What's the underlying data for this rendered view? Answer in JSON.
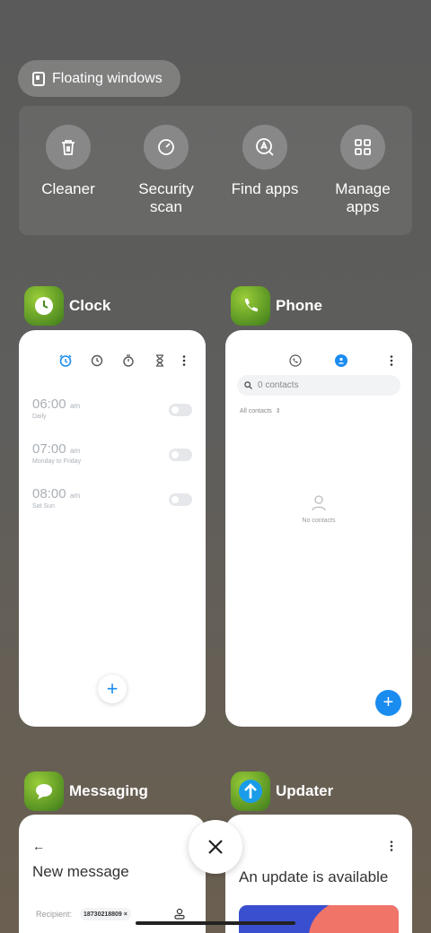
{
  "floating_windows": {
    "label": "Floating windows",
    "icon": "floating-window-icon"
  },
  "tools": [
    {
      "label": "Cleaner",
      "icon": "trash-icon"
    },
    {
      "label": "Security\nscan",
      "icon": "security-scan-icon"
    },
    {
      "label": "Find apps",
      "icon": "find-apps-icon"
    },
    {
      "label": "Manage\napps",
      "icon": "grid-icon"
    }
  ],
  "apps": {
    "clock": {
      "name": "Clock",
      "alarms": [
        {
          "time": "06:00",
          "ampm": "am",
          "repeat": "Daily",
          "enabled": false
        },
        {
          "time": "07:00",
          "ampm": "am",
          "repeat": "Monday to Friday",
          "enabled": false
        },
        {
          "time": "08:00",
          "ampm": "am",
          "repeat": "Sat Sun",
          "enabled": false
        }
      ],
      "add": "+"
    },
    "phone": {
      "name": "Phone",
      "search_placeholder": "0 contacts",
      "filter_label": "All contacts",
      "empty_label": "No contacts",
      "add": "+"
    },
    "messaging": {
      "name": "Messaging",
      "title": "New message",
      "recipient_label": "Recipient:",
      "recipient_chip": "18730218809 ×"
    },
    "updater": {
      "name": "Updater",
      "title": "An update is available"
    }
  },
  "close_label": "×",
  "colors": {
    "accent": "#1a8cf0",
    "card_bg": "#ffffff",
    "muted_text": "#aab0b7"
  }
}
